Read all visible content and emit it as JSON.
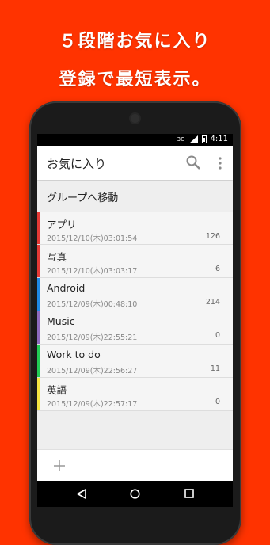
{
  "promo": {
    "line1": "５段階お気に入り",
    "line2": "登録で最短表示。"
  },
  "statusbar": {
    "network": "3G",
    "time": "4:11"
  },
  "toolbar": {
    "title": "お気に入り",
    "search_icon": "search-icon",
    "overflow_icon": "overflow-menu-icon"
  },
  "group_move": {
    "label": "グループへ移動"
  },
  "favorites": [
    {
      "name": "アプリ",
      "date": "2015/12/10(木)03:01:54",
      "count": "126",
      "color": "#e53935"
    },
    {
      "name": "写真",
      "date": "2015/12/10(木)03:03:17",
      "count": "6",
      "color": "#e53935"
    },
    {
      "name": "Android",
      "date": "2015/12/09(木)00:48:10",
      "count": "214",
      "color": "#1e88e5"
    },
    {
      "name": "Music",
      "date": "2015/12/09(木)22:55:21",
      "count": "0",
      "color": "#8e6bbf"
    },
    {
      "name": "Work to do",
      "date": "2015/12/09(木)22:56:27",
      "count": "11",
      "color": "#22cc55"
    },
    {
      "name": "英語",
      "date": "2015/12/09(木)22:57:17",
      "count": "0",
      "color": "#f5e642"
    }
  ],
  "bottom_bar": {
    "add_icon": "plus-icon"
  },
  "navbar": {
    "back_icon": "back-triangle-icon",
    "home_icon": "home-circle-icon",
    "recent_icon": "recent-square-icon"
  }
}
